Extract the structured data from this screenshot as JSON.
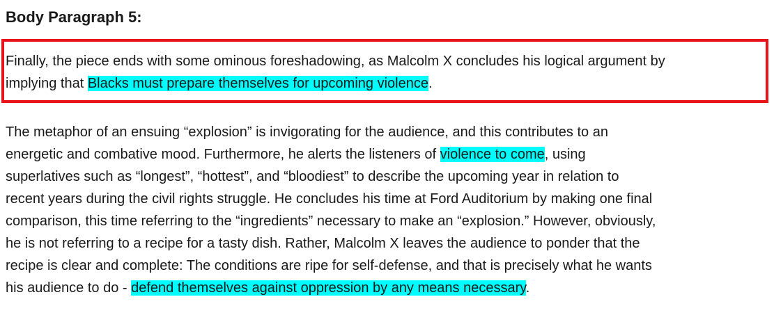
{
  "heading": "Body Paragraph 5:",
  "paragraph1": {
    "line1": "Finally, the piece ends with some ominous foreshadowing, as Malcolm X concludes his logical argument by",
    "line2_pre": "implying that ",
    "line2_highlight": "Blacks must prepare themselves for upcoming violence",
    "line2_post": "."
  },
  "paragraph2": {
    "line1": "The metaphor of an ensuing “explosion” is invigorating for the audience, and this contributes to an",
    "line2_pre": "energetic and combative mood.  Furthermore, he alerts the listeners of ",
    "line2_highlight": "violence to come",
    "line2_post": ", using",
    "line3": "superlatives such as “longest”, “hottest”, and “bloodiest” to describe the upcoming year in relation to",
    "line4": "recent years during the civil rights struggle.  He concludes his time at Ford Auditorium by making one final",
    "line5": "comparison, this time referring to the “ingredients” necessary to make an “explosion.”  However, obviously,",
    "line6": "he is not referring to a recipe for a tasty dish.  Rather, Malcolm X leaves the audience to ponder that the",
    "line7": "recipe is clear and complete:  The conditions are ripe for self-defense, and that is precisely what he wants",
    "line8_pre": "his audience to do - ",
    "line8_highlight": "defend themselves against oppression by any means necessary",
    "line8_post": "."
  },
  "colors": {
    "highlight": "#00fdfd",
    "box_border": "#e8141b"
  }
}
